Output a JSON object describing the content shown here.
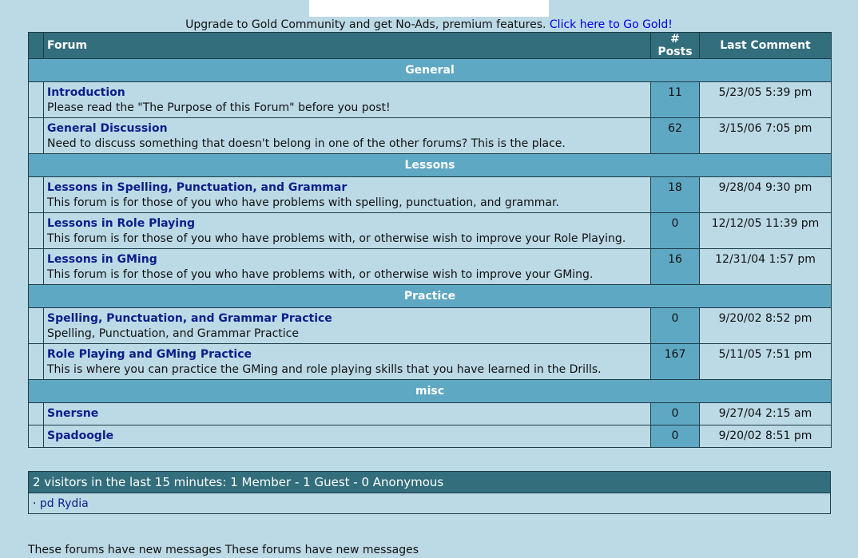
{
  "upgrade": {
    "text": "Upgrade to Gold Community and get No-Ads, premium features.",
    "link": "Click here to Go Gold!"
  },
  "headers": {
    "forum": "Forum",
    "posts": "# Posts",
    "last": "Last Comment"
  },
  "categories": [
    {
      "name": "General",
      "forums": [
        {
          "title": "Introduction",
          "desc": "Please read the \"The Purpose of this Forum\" before you post!",
          "posts": "11",
          "last": "5/23/05 5:39 pm"
        },
        {
          "title": "General Discussion",
          "desc": "Need to discuss something that doesn't belong in one of the other forums? This is the place.",
          "posts": "62",
          "last": "3/15/06 7:05 pm"
        }
      ]
    },
    {
      "name": "Lessons",
      "forums": [
        {
          "title": "Lessons in Spelling, Punctuation, and Grammar",
          "desc": "This forum is for those of you who have problems with spelling, punctuation, and grammar.",
          "posts": "18",
          "last": "9/28/04 9:30 pm"
        },
        {
          "title": "Lessons in Role Playing",
          "desc": "This forum is for those of you who have problems with, or otherwise wish to improve your Role Playing.",
          "posts": "0",
          "last": "12/12/05 11:39 pm"
        },
        {
          "title": "Lessons in GMing",
          "desc": "This forum is for those of you who have problems with, or otherwise wish to improve your GMing.",
          "posts": "16",
          "last": "12/31/04 1:57 pm"
        }
      ]
    },
    {
      "name": "Practice",
      "forums": [
        {
          "title": "Spelling, Punctuation, and Grammar Practice",
          "desc": "Spelling, Punctuation, and Grammar Practice",
          "posts": "0",
          "last": "9/20/02 8:52 pm"
        },
        {
          "title": "Role Playing and GMing Practice",
          "desc": "This is where you can practice the GMing and role playing skills that you have learned in the Drills.",
          "posts": "167",
          "last": "5/11/05 7:51 pm"
        }
      ]
    },
    {
      "name": "misc",
      "forums": [
        {
          "title": "Snersne",
          "desc": "",
          "posts": "0",
          "last": "9/27/04 2:15 am"
        },
        {
          "title": "Spadoogle",
          "desc": "",
          "posts": "0",
          "last": "9/20/02 8:51 pm"
        }
      ]
    }
  ],
  "visitors": {
    "summary": "2 visitors in the last 15 minutes: 1 Member - 1 Guest - 0 Anonymous",
    "bullet": "·",
    "member": "pd Rydia"
  },
  "footer": "These forums have new messages These forums have new messages",
  "colors": {
    "header": "#336e7d",
    "category": "#5fa8c3",
    "background": "#bcdae6",
    "link": "#0a1e8a"
  }
}
